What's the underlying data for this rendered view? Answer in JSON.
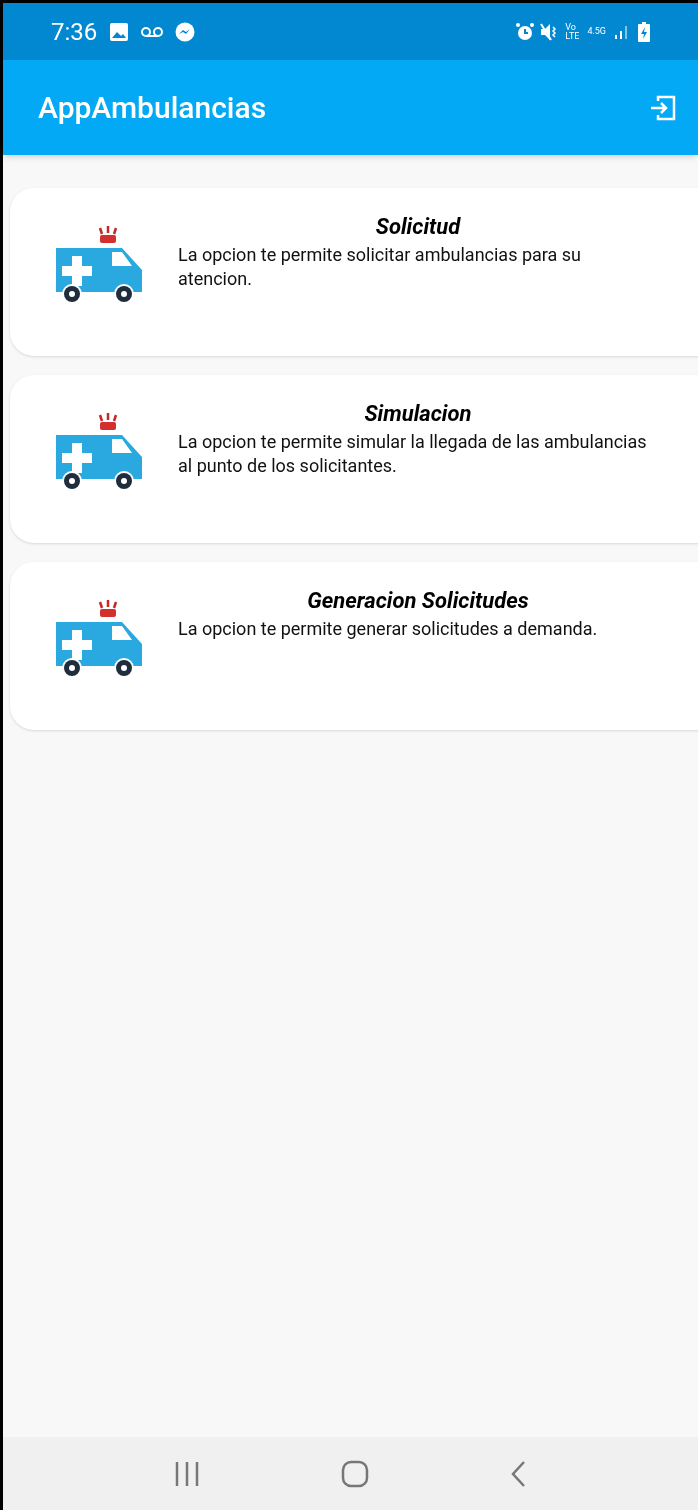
{
  "status_bar": {
    "time": "7:36",
    "volte_top": "Vo",
    "volte_bottom": "LTE",
    "network": "4.5G"
  },
  "app_bar": {
    "title": "AppAmbulancias"
  },
  "options": [
    {
      "title": "Solicitud",
      "description": "La opcion te permite solicitar ambulancias para su atencion."
    },
    {
      "title": "Simulacion",
      "description": "La opcion te permite simular la llegada de las ambulancias al punto de los solicitantes."
    },
    {
      "title": "Generacion Solicitudes",
      "description": "La opcion te permite generar solicitudes a demanda."
    }
  ]
}
